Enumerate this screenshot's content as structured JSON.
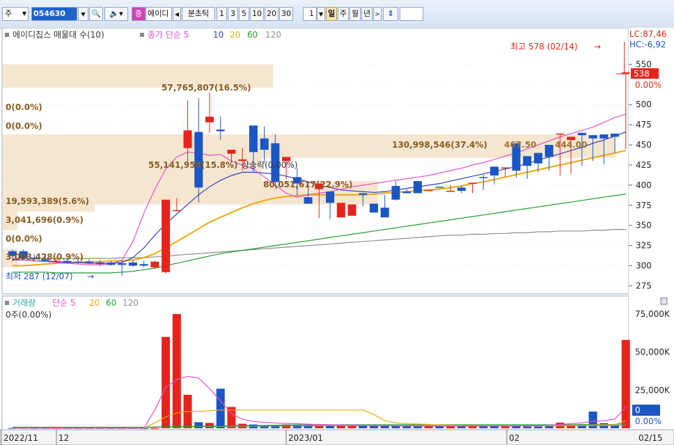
{
  "toolbar": {
    "market": "주",
    "code": "054630",
    "type_button": "증",
    "name": "에이디",
    "view_button": "분초틱",
    "intervals": [
      "1",
      "3",
      "5",
      "10",
      "20",
      "30"
    ],
    "interval_value": "1",
    "periods": [
      "일",
      "주",
      "월",
      "년"
    ],
    "active_period": "일"
  },
  "price_panel": {
    "legend": {
      "series_label": "에이디칩스 매물대 수(10)",
      "ma_label": "종가 단순 5",
      "ma_periods": [
        "10",
        "20",
        "60",
        "120"
      ]
    },
    "lc": "LC:87,46",
    "hc": "HC:-6,92",
    "current_price": "538",
    "current_change": "0.00%",
    "high_annotation": "최고 578 (02/14)",
    "low_annotation": "최저 287 (12/07)",
    "volume_profile": [
      {
        "label": "0(0.0%)",
        "lo": 550,
        "hi": 578
      },
      {
        "label": "57,765,807(16.5%)",
        "lo": 521,
        "hi": 550
      },
      {
        "label": "0(0.0%)",
        "lo": 492,
        "hi": 521
      },
      {
        "label": "0(0.0%)",
        "lo": 463,
        "hi": 492
      },
      {
        "label": "130,998,546(37.4%)",
        "lo": 434,
        "hi": 463
      },
      {
        "label": "55,141,958(15.8%)",
        "lo": 405,
        "hi": 434
      },
      {
        "label": "80,051,617(22.9%)",
        "lo": 376,
        "hi": 405
      },
      {
        "label": "19,593,389(5.6%)",
        "lo": 367,
        "hi": 392
      },
      {
        "label": "3,041,696(0.9%)",
        "lo": 344,
        "hi": 367
      },
      {
        "label": "0(0.0%)",
        "lo": 321,
        "hi": 344
      },
      {
        "label": "3,003,428(0.9%)",
        "lo": 298,
        "hi": 321
      }
    ],
    "extra_labels": [
      "상승락(0.00%)",
      "467.50",
      "444.00"
    ]
  },
  "volume_panel": {
    "legend": {
      "series_label": "거래량",
      "ma_label": "단순 5",
      "ma_periods": [
        "20",
        "60",
        "120"
      ]
    },
    "info": "0주(0.00%)",
    "current_value": "0",
    "current_change": "0.00%"
  },
  "x_axis_labels": [
    "2022/11",
    "12",
    "2023/01",
    "02",
    "02/15"
  ],
  "colors": {
    "up": "#e8231c",
    "down": "#1b56c4",
    "ma5": "#e64fc8",
    "ma10": "#2c3fc1",
    "ma20": "#f0a70c",
    "ma60": "#1f9a2f",
    "ma120": "#8c8c8c",
    "profile": "#f6e6d0"
  },
  "chart_data": {
    "type": "candlestick",
    "ylim": [
      265,
      578
    ],
    "y_ticks": [
      275,
      300,
      325,
      350,
      375,
      400,
      425,
      450,
      475,
      500,
      525,
      550
    ],
    "volume_ylim": [
      0,
      80000
    ],
    "volume_ticks": [
      "25,000K",
      "50,000K",
      "75,000K"
    ],
    "ohlc": [
      [
        318,
        320,
        308,
        312
      ],
      [
        318,
        320,
        307,
        309
      ],
      [
        310,
        314,
        306,
        308
      ],
      [
        308,
        312,
        306,
        307
      ],
      [
        306,
        310,
        304,
        306
      ],
      [
        306,
        309,
        303,
        305
      ],
      [
        305,
        308,
        302,
        304
      ],
      [
        305,
        308,
        302,
        304
      ],
      [
        304,
        307,
        300,
        302
      ],
      [
        304,
        306,
        300,
        301
      ],
      [
        303,
        306,
        287,
        301
      ],
      [
        304,
        307,
        299,
        300
      ],
      [
        302,
        306,
        298,
        300
      ],
      [
        298,
        306,
        296,
        305
      ],
      [
        292,
        370,
        290,
        382
      ],
      [
        369,
        373,
        384,
        369
      ],
      [
        446,
        422,
        505,
        468
      ],
      [
        466,
        508,
        378,
        397
      ],
      [
        478,
        465,
        515,
        485
      ],
      [
        469,
        456,
        485,
        467
      ],
      [
        439,
        435,
        428,
        444
      ],
      [
        430,
        446,
        418,
        432
      ],
      [
        474,
        416,
        466,
        441
      ],
      [
        458,
        428,
        473,
        444
      ],
      [
        452,
        398,
        463,
        404
      ],
      [
        430,
        407,
        428,
        435
      ],
      [
        410,
        387,
        421,
        402
      ],
      [
        385,
        404,
        402,
        377
      ],
      [
        395,
        372,
        359,
        402
      ],
      [
        392,
        358,
        364,
        378
      ],
      [
        360,
        376,
        364,
        378
      ],
      [
        362,
        374,
        364,
        376
      ],
      [
        390,
        376,
        374,
        388
      ],
      [
        377,
        366,
        376,
        366
      ],
      [
        372,
        361,
        388,
        360
      ],
      [
        399,
        405,
        381,
        382
      ],
      [
        392,
        392,
        395,
        390
      ],
      [
        405,
        405,
        400,
        390
      ],
      [
        394,
        394,
        394,
        394
      ],
      [
        398,
        397,
        398,
        397
      ],
      [
        392,
        399,
        400,
        393
      ],
      [
        397,
        390,
        399,
        393
      ],
      [
        403,
        390,
        399,
        403
      ],
      [
        410,
        394,
        413,
        409
      ],
      [
        423,
        401,
        412,
        412
      ],
      [
        421,
        412,
        410,
        422
      ],
      [
        452,
        409,
        432,
        418
      ],
      [
        436,
        408,
        422,
        424
      ],
      [
        440,
        416,
        427,
        427
      ],
      [
        450,
        418,
        433,
        435
      ],
      [
        464,
        412,
        448,
        464
      ],
      [
        456,
        414,
        456,
        460
      ],
      [
        465,
        424,
        460,
        462
      ],
      [
        462,
        430,
        430,
        458
      ],
      [
        463,
        426,
        445,
        458
      ],
      [
        464,
        440,
        442,
        460
      ],
      [
        540,
        446,
        445,
        540
      ]
    ],
    "volume": [
      150,
      140,
      130,
      120,
      110,
      110,
      100,
      100,
      100,
      90,
      90,
      100,
      80,
      80,
      60000,
      75000,
      22000,
      4000,
      3500,
      26000,
      14000,
      3000,
      2500,
      2000,
      2000,
      2500,
      2500,
      2000,
      1800,
      1500,
      2200,
      1800,
      1600,
      1500,
      1400,
      1400,
      1300,
      1300,
      1200,
      1200,
      1500,
      1400,
      1300,
      1300,
      1500,
      1200,
      1700,
      1200,
      1200,
      1400,
      3700,
      2500,
      2700,
      11000,
      3400,
      2200,
      58000
    ],
    "ma5_price": [
      308,
      307,
      306,
      305,
      304,
      303,
      302,
      301,
      301,
      302,
      307,
      330,
      365,
      395,
      420,
      435,
      441,
      440,
      437,
      438,
      430,
      425,
      420,
      410,
      400,
      390,
      385,
      388,
      390,
      392,
      395,
      398,
      400,
      402,
      404,
      406,
      408,
      410,
      412,
      415,
      418,
      421,
      425,
      428,
      432,
      436,
      440,
      445,
      450,
      455,
      460,
      464,
      468,
      472,
      478,
      484,
      488
    ],
    "ma10_price": [
      307,
      307,
      306,
      306,
      305,
      304,
      304,
      303,
      303,
      303,
      304,
      310,
      322,
      338,
      352,
      364,
      376,
      388,
      398,
      406,
      412,
      416,
      416,
      415,
      414,
      411,
      408,
      404,
      400,
      397,
      394,
      393,
      392,
      391,
      392,
      394,
      396,
      398,
      400,
      402,
      405,
      408,
      411,
      414,
      417,
      420,
      423,
      427,
      431,
      435,
      439,
      443,
      447,
      452,
      456,
      461,
      466
    ],
    "ma20_price": [
      300,
      300,
      301,
      302,
      303,
      304,
      304,
      305,
      305,
      306,
      306,
      307,
      310,
      315,
      322,
      330,
      338,
      346,
      354,
      360,
      366,
      372,
      377,
      381,
      384,
      386,
      387,
      388,
      388,
      388,
      388,
      388,
      388,
      389,
      390,
      391,
      392,
      393,
      394,
      395,
      397,
      399,
      402,
      404,
      407,
      410,
      413,
      416,
      419,
      422,
      425,
      428,
      431,
      434,
      437,
      440,
      443
    ],
    "ma60_price": [
      292,
      292,
      292,
      292,
      291,
      291,
      291,
      291,
      291,
      291,
      292,
      293,
      295,
      297,
      300,
      303,
      306,
      309,
      312,
      315,
      317,
      319,
      321,
      323,
      325,
      327,
      329,
      331,
      333,
      335,
      337,
      339,
      341,
      343,
      345,
      347,
      349,
      351,
      353,
      355,
      357,
      359,
      361,
      363,
      365,
      367,
      369,
      371,
      373,
      375,
      377,
      379,
      381,
      383,
      385,
      387,
      389
    ],
    "ma120_price": [
      309,
      309,
      309,
      309,
      309,
      309,
      309,
      309,
      309,
      309,
      310,
      310,
      310,
      311,
      312,
      313,
      314,
      315,
      316,
      317,
      318,
      319,
      320,
      321,
      322,
      323,
      324,
      325,
      326,
      327,
      328,
      329,
      330,
      331,
      332,
      333,
      334,
      335,
      336,
      337,
      338,
      338,
      339,
      339,
      340,
      340,
      341,
      341,
      342,
      342,
      343,
      343,
      343,
      344,
      344,
      345,
      345
    ],
    "ma5_volume": [
      120,
      120,
      120,
      115,
      110,
      105,
      100,
      100,
      95,
      95,
      90,
      95,
      90,
      12000,
      27000,
      32000,
      34000,
      33000,
      26000,
      18000,
      9500,
      6000,
      4500,
      4000,
      3500,
      3200,
      3000,
      2700,
      2500,
      2400,
      2200,
      2000,
      1900,
      1800,
      1700,
      1600,
      1500,
      1450,
      1400,
      1400,
      1450,
      1400,
      1400,
      1450,
      1450,
      1400,
      1500,
      1600,
      1700,
      2000,
      2500,
      3000,
      3600,
      4500,
      5000,
      6000,
      14000
    ],
    "ma20_volume": [
      200,
      200,
      200,
      200,
      200,
      200,
      200,
      200,
      200,
      200,
      200,
      200,
      200,
      3500,
      7500,
      10000,
      11000,
      11000,
      11500,
      12000,
      12000,
      12000,
      12000,
      12000,
      12000,
      12000,
      12000,
      12000,
      12000,
      12000,
      12000,
      12000,
      12000,
      9000,
      5000,
      3500,
      3000,
      2800,
      2500,
      2200,
      2000,
      1800,
      1700,
      1600,
      1600,
      1500,
      1500,
      1500,
      1500,
      1600,
      1700,
      1800,
      1900,
      2100,
      2300,
      2400,
      5000
    ],
    "ma60_volume": [
      500,
      500,
      500,
      500,
      500,
      500,
      500,
      500,
      500,
      500,
      500,
      500,
      500,
      700,
      900,
      1100,
      1200,
      1300,
      1400,
      1500,
      1600,
      1700,
      1800,
      1900,
      2000,
      2100,
      2150,
      2200,
      2250,
      2300,
      2300,
      2300,
      2300,
      2300,
      2300,
      2300,
      2300,
      2300,
      2300,
      2300,
      2300,
      2300,
      2300,
      2300,
      2300,
      2300,
      2300,
      2300,
      2300,
      2300,
      2300,
      2300,
      2350,
      2400,
      2450,
      2500,
      3200
    ],
    "ma120_volume": [
      800,
      800,
      800,
      800,
      800,
      800,
      800,
      800,
      800,
      800,
      800,
      800,
      800,
      850,
      900,
      950,
      1000,
      1050,
      1100,
      1150,
      1200,
      1250,
      1300,
      1350,
      1400,
      1450,
      1500,
      1550,
      1600,
      1650,
      1700,
      1700,
      1700,
      1700,
      1700,
      1700,
      1700,
      1700,
      1700,
      1700,
      1700,
      1700,
      1700,
      1700,
      1700,
      1700,
      1700,
      1700,
      1700,
      1700,
      1700,
      1700,
      1700,
      1750,
      1800,
      1850,
      2000
    ]
  }
}
